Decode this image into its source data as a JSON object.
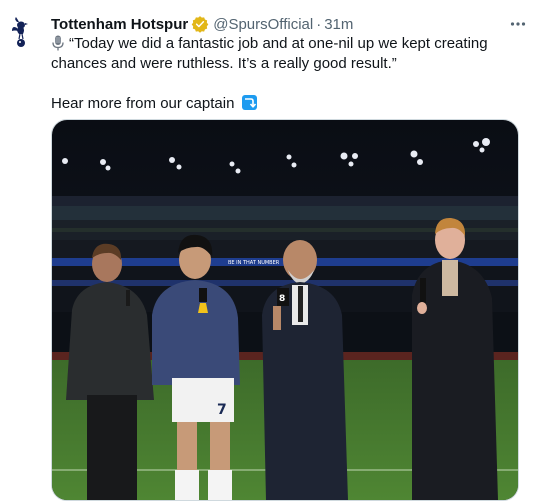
{
  "tweet": {
    "author_name": "Tottenham Hotspur",
    "handle": "@SpursOfficial",
    "separator": "·",
    "time": "31m",
    "quote_line_1": "“Today we did a fantastic job and at one-nil up we kept creating",
    "quote_line_2": "chances and were ruthless. It’s a really good result.”",
    "cta_text": "Hear more from our captain",
    "icons": {
      "avatar": "tottenham-cockerel-logo",
      "verified": "gold-verified-badge",
      "more": "more-horizontal-icon",
      "mic": "microphone-icon",
      "arrow": "arrow-right-curving-down-icon"
    },
    "colors": {
      "text": "#0f1419",
      "secondary": "#536471",
      "verified_gold": "#e2b719",
      "link_blue": "#1d9bf0"
    }
  },
  "media": {
    "type": "video-thumbnail",
    "description_text": "",
    "board_text": "BE IN THAT NUMBER",
    "shirt_number": "7",
    "mic_flag": "8"
  }
}
